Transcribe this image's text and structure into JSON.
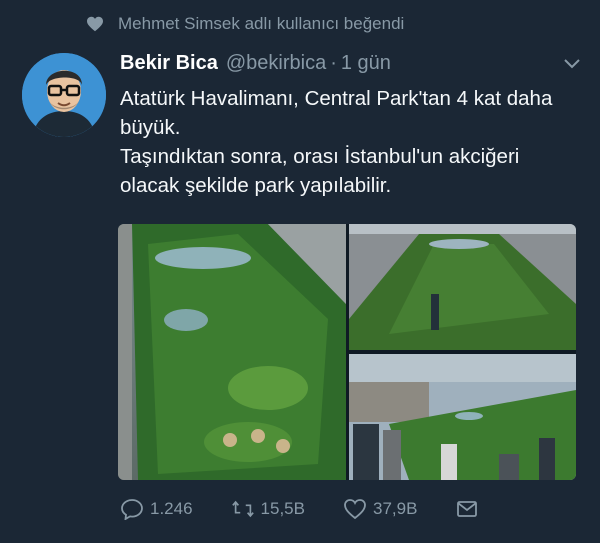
{
  "social_context": {
    "icon": "heart-icon",
    "text": "Mehmet Simsek adlı kullanıcı beğendi"
  },
  "tweet": {
    "author_name": "Bekir Bica",
    "handle": "@bekirbica",
    "separator": "·",
    "time": "1 gün",
    "line1": "Atatürk Havalimanı, Central Park'tan 4 kat daha büyük.",
    "line2": "Taşındıktan sonra, orası İstanbul'un akciğeri olacak şekilde park yapılabilir.",
    "images": [
      "central-park-aerial-1",
      "central-park-aerial-2",
      "central-park-aerial-3"
    ]
  },
  "actions": {
    "replies": "1.246",
    "retweets": "15,5B",
    "likes": "37,9B"
  },
  "colors": {
    "background": "#1b2735",
    "muted": "#8899a6",
    "text": "#ffffff"
  }
}
